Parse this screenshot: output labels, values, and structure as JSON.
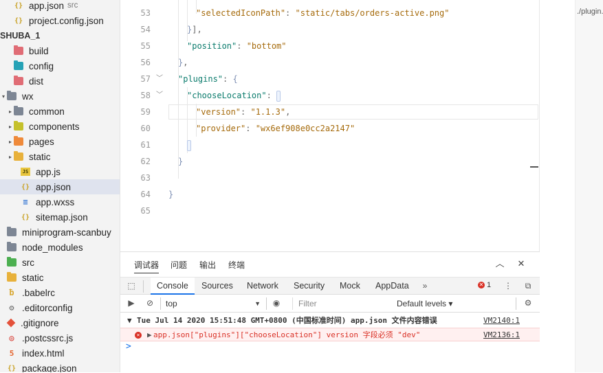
{
  "sidebar": {
    "rows": [
      {
        "label": "app.json",
        "hint": "src",
        "icon": "json-icon"
      },
      {
        "label": "project.config.json",
        "hint": "",
        "icon": "json-icon"
      },
      {
        "label": "SHUBA_1",
        "hint": "",
        "icon": ""
      },
      {
        "label": "build",
        "hint": "",
        "icon": "folder-icon"
      },
      {
        "label": "config",
        "hint": "",
        "icon": "folder-icon"
      },
      {
        "label": "dist",
        "hint": "",
        "icon": "folder-icon"
      },
      {
        "label": "wx",
        "hint": "",
        "icon": "folder-open-icon"
      },
      {
        "label": "common",
        "hint": "",
        "icon": "folder-icon"
      },
      {
        "label": "components",
        "hint": "",
        "icon": "folder-icon"
      },
      {
        "label": "pages",
        "hint": "",
        "icon": "folder-icon"
      },
      {
        "label": "static",
        "hint": "",
        "icon": "folder-icon"
      },
      {
        "label": "app.js",
        "hint": "",
        "icon": "js-icon"
      },
      {
        "label": "app.json",
        "hint": "",
        "icon": "json-icon"
      },
      {
        "label": "app.wxss",
        "hint": "",
        "icon": "css-icon"
      },
      {
        "label": "sitemap.json",
        "hint": "",
        "icon": "json-icon"
      },
      {
        "label": "miniprogram-scanbuy",
        "hint": "",
        "icon": "folder-icon"
      },
      {
        "label": "node_modules",
        "hint": "",
        "icon": "folder-icon"
      },
      {
        "label": "src",
        "hint": "",
        "icon": "folder-icon"
      },
      {
        "label": "static",
        "hint": "",
        "icon": "folder-icon"
      },
      {
        "label": ".babelrc",
        "hint": "",
        "icon": "babel-icon"
      },
      {
        "label": ".editorconfig",
        "hint": "",
        "icon": "gear-icon"
      },
      {
        "label": ".gitignore",
        "hint": "",
        "icon": "git-icon"
      },
      {
        "label": ".postcssrc.js",
        "hint": "",
        "icon": "postcss-icon"
      },
      {
        "label": "index.html",
        "hint": "",
        "icon": "html-icon"
      },
      {
        "label": "package.json",
        "hint": "",
        "icon": "json-icon"
      }
    ]
  },
  "editor": {
    "lines": [
      {
        "num": "53",
        "parts": [
          [
            "s",
            "\"selectedIconPath\""
          ],
          [
            "p",
            ": "
          ],
          [
            "s",
            "\"static/tabs/orders-active.png\""
          ]
        ]
      },
      {
        "num": "54",
        "parts": [
          [
            "b",
            "}"
          ],
          [
            "p",
            "],"
          ]
        ]
      },
      {
        "num": "55",
        "parts": [
          [
            "k",
            "\"position\""
          ],
          [
            "p",
            ": "
          ],
          [
            "s",
            "\"bottom\""
          ]
        ]
      },
      {
        "num": "56",
        "parts": [
          [
            "b",
            "}"
          ],
          [
            "p",
            ","
          ]
        ]
      },
      {
        "num": "57",
        "parts": [
          [
            "k",
            "\"plugins\""
          ],
          [
            "p",
            ": "
          ],
          [
            "b",
            "{"
          ]
        ]
      },
      {
        "num": "58",
        "parts": [
          [
            "k",
            "\"chooseLocation\""
          ],
          [
            "p",
            ": "
          ]
        ]
      },
      {
        "num": "59",
        "parts": [
          [
            "s",
            "\"version\""
          ],
          [
            "p",
            ": "
          ],
          [
            "s",
            "\"1.1.3\""
          ],
          [
            "p",
            ","
          ]
        ]
      },
      {
        "num": "60",
        "parts": [
          [
            "s",
            "\"provider\""
          ],
          [
            "p",
            ": "
          ],
          [
            "s",
            "\"wx6ef908e0cc2a2147\""
          ]
        ]
      },
      {
        "num": "61",
        "parts": []
      },
      {
        "num": "62",
        "parts": [
          [
            "b",
            "}"
          ]
        ]
      },
      {
        "num": "63",
        "parts": []
      },
      {
        "num": "64",
        "parts": [
          [
            "b",
            "}"
          ]
        ]
      },
      {
        "num": "65",
        "parts": []
      }
    ]
  },
  "rightpanel": {
    "text": "./plugin.i"
  },
  "panel": {
    "tabs": [
      "调试器",
      "问题",
      "输出",
      "终端"
    ],
    "devtools_tabs": [
      "Console",
      "Sources",
      "Network",
      "Security",
      "Mock",
      "AppData"
    ],
    "error_count": "1",
    "context": "top",
    "filter_placeholder": "Filter",
    "levels": "Default levels",
    "console": {
      "header": "Tue Jul 14 2020 15:51:48 GMT+0800 (中国标准时间) app.json 文件内容错误",
      "header_src": "VM2140:1",
      "error": "app.json[\"plugins\"][\"chooseLocation\"] version 字段必须 \"dev\"",
      "error_src": "VM2136:1",
      "prompt": ">"
    }
  },
  "colors": {
    "accent": "#1a73e8",
    "error": "#d93025",
    "selected": "#dfe3ee"
  }
}
